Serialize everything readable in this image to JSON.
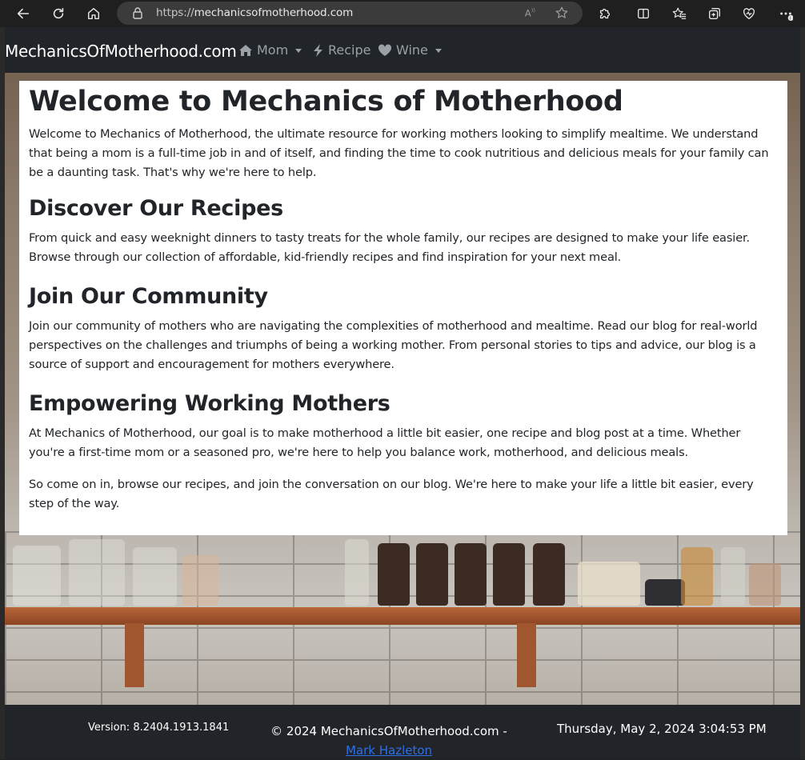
{
  "browser": {
    "url_prefix": "https://",
    "url_host": "mechanicsofmotherhood.com",
    "icons": {
      "back": "back-arrow-icon",
      "refresh": "refresh-icon",
      "home": "home-icon",
      "lock": "lock-icon",
      "read_aloud": "read-aloud-icon",
      "favorite": "star-icon",
      "extensions": "puzzle-icon",
      "split": "split-screen-icon",
      "favorites": "favorites-icon",
      "collections": "collections-icon",
      "health": "browser-essentials-icon",
      "menu": "more-icon"
    }
  },
  "navbar": {
    "brand": "MechanicsOfMotherhood.com",
    "items": [
      {
        "label": "Mom",
        "icon": "home-icon",
        "dropdown": true
      },
      {
        "label": "Recipe",
        "icon": "bolt-icon",
        "dropdown": false
      },
      {
        "label": "Wine",
        "icon": "heart-icon",
        "dropdown": true
      }
    ]
  },
  "main": {
    "title": "Welcome to Mechanics of Motherhood",
    "intro": "Welcome to Mechanics of Motherhood, the ultimate resource for working mothers looking to simplify mealtime. We understand that being a mom is a full-time job in and of itself, and finding the time to cook nutritious and delicious meals for your family can be a daunting task. That's why we're here to help.",
    "sections": [
      {
        "heading": "Discover Our Recipes",
        "paragraphs": [
          "From quick and easy weeknight dinners to tasty treats for the whole family, our recipes are designed to make your life easier. Browse through our collection of affordable, kid-friendly recipes and find inspiration for your next meal."
        ]
      },
      {
        "heading": "Join Our Community",
        "paragraphs": [
          "Join our community of mothers who are navigating the complexities of motherhood and mealtime. Read our blog for real-world perspectives on the challenges and triumphs of being a working mother. From personal stories to tips and advice, our blog is a source of support and encouragement for mothers everywhere."
        ]
      },
      {
        "heading": "Empowering Working Mothers",
        "paragraphs": [
          "At Mechanics of Motherhood, our goal is to make motherhood a little bit easier, one recipe and blog post at a time. Whether you're a first-time mom or a seasoned pro, we're here to help you balance work, motherhood, and delicious meals.",
          "So come on in, browse our recipes, and join the conversation on our blog. We're here to make your life a little bit easier, every step of the way."
        ]
      }
    ]
  },
  "footer": {
    "version": "Version: 8.2404.1913.1841",
    "copyright": "© 2024 MechanicsOfMotherhood.com -",
    "author_link": "Mark Hazleton",
    "datetime": "Thursday, May 2, 2024 3:04:53 PM"
  },
  "colors": {
    "navbar_bg": "#212529",
    "link": "#2f6fe4",
    "chrome_bg": "#1f1f1f",
    "address_bg": "#3b3b3b"
  }
}
